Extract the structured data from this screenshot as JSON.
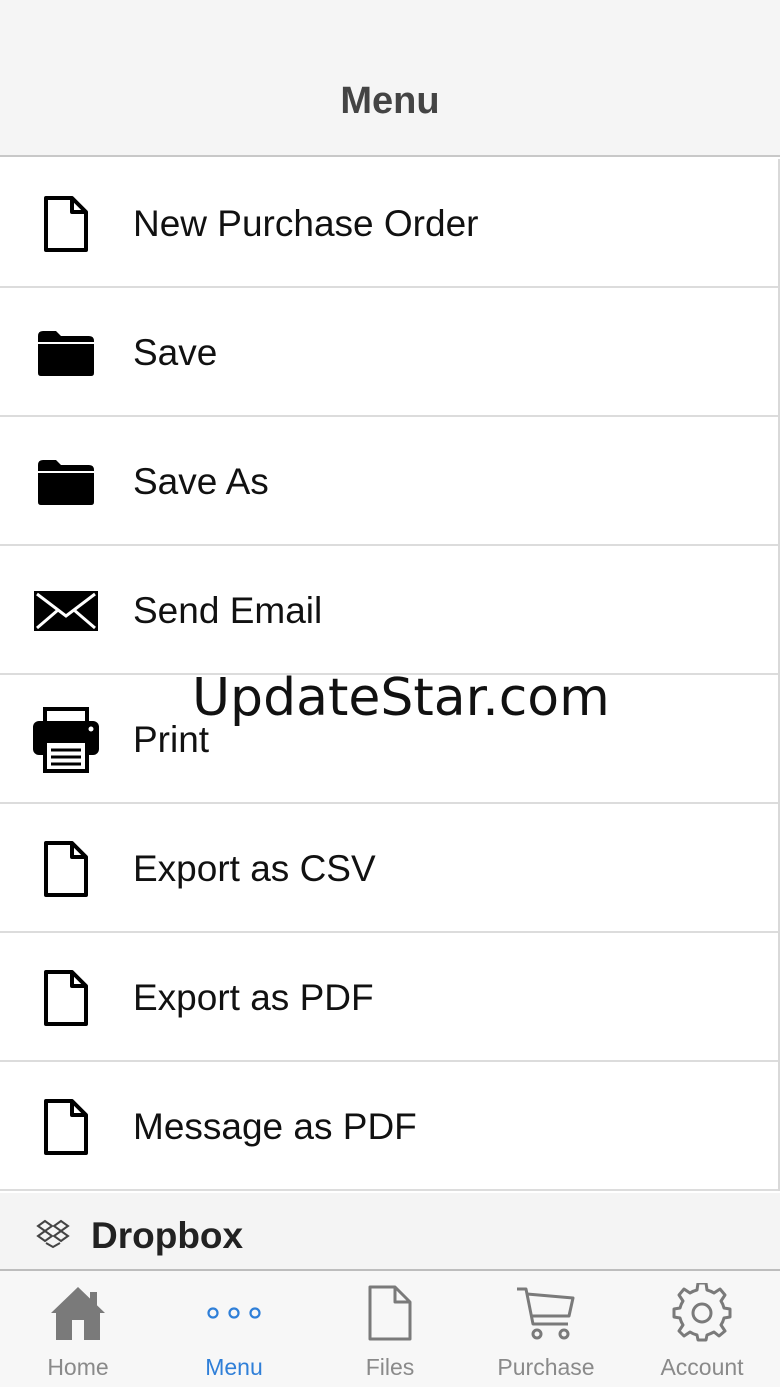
{
  "header": {
    "title": "Menu"
  },
  "menu": {
    "items": [
      {
        "label": "New Purchase Order",
        "icon": "document-icon"
      },
      {
        "label": "Save",
        "icon": "folder-icon"
      },
      {
        "label": "Save As",
        "icon": "folder-icon"
      },
      {
        "label": "Send Email",
        "icon": "envelope-icon"
      },
      {
        "label": "Print",
        "icon": "printer-icon"
      },
      {
        "label": "Export as CSV",
        "icon": "document-icon"
      },
      {
        "label": "Export as PDF",
        "icon": "document-icon"
      },
      {
        "label": "Message as PDF",
        "icon": "document-icon"
      }
    ]
  },
  "section": {
    "label": "Dropbox",
    "icon": "dropbox-icon"
  },
  "watermark": {
    "text": "UpdateStar.com"
  },
  "tabbar": {
    "active_color": "#2f7fd8",
    "inactive_color": "#8a8a8a",
    "tabs": [
      {
        "label": "Home",
        "icon": "home-icon",
        "active": false
      },
      {
        "label": "Menu",
        "icon": "more-dots-icon",
        "active": true
      },
      {
        "label": "Files",
        "icon": "file-icon",
        "active": false
      },
      {
        "label": "Purchase",
        "icon": "cart-icon",
        "active": false
      },
      {
        "label": "Account",
        "icon": "gear-icon",
        "active": false
      }
    ]
  }
}
